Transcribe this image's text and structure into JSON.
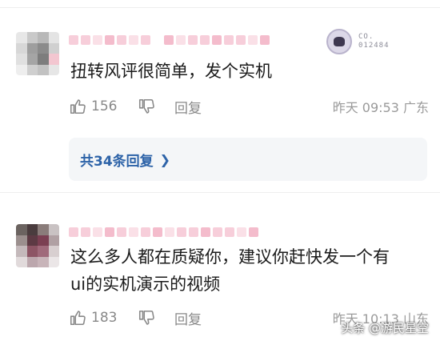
{
  "comments": [
    {
      "text": "扭转风评很简单，发个实机",
      "likes": "156",
      "reply_label": "回复",
      "meta": "昨天 09:53 广东",
      "replies_label": "共34条回复",
      "badge_text_line1": "CO.",
      "badge_text_line2": "012484"
    },
    {
      "text_line1": "这么多人都在质疑你，建议你赶快发一个有",
      "text_line2": "ui的实机演示的视频",
      "likes": "183",
      "reply_label": "回复",
      "meta": "昨天 10:13 山东"
    }
  ],
  "watermark": "头条 @游民星空",
  "colors": {
    "link_blue": "#2d63a8",
    "muted_gray": "#888888",
    "reply_box_bg": "#f4f6f8"
  }
}
